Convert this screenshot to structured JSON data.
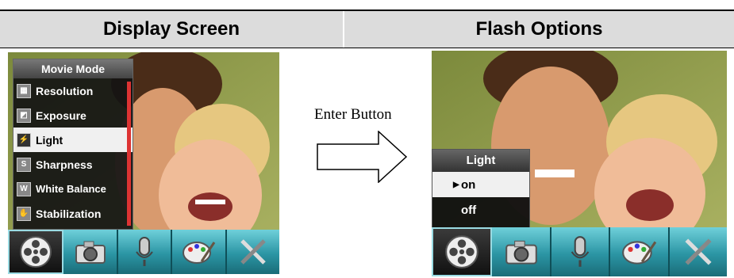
{
  "headers": {
    "left": "Display Screen",
    "right": "Flash Options"
  },
  "arrow_label": "Enter Button",
  "left_screen": {
    "menu": {
      "title": "Movie Mode",
      "items": [
        {
          "label": "Resolution",
          "icon": "resolution-icon",
          "selected": false
        },
        {
          "label": "Exposure",
          "icon": "exposure-icon",
          "selected": false
        },
        {
          "label": "Light",
          "icon": "light-icon",
          "selected": true
        },
        {
          "label": "Sharpness",
          "icon": "sharpness-icon",
          "selected": false
        },
        {
          "label": "White Balance",
          "icon": "white-balance-icon",
          "selected": false
        },
        {
          "label": "Stabilization",
          "icon": "stabilization-icon",
          "selected": false
        }
      ]
    }
  },
  "right_screen": {
    "popup": {
      "title": "Light",
      "options": [
        {
          "label": "on",
          "selected": true
        },
        {
          "label": "off",
          "selected": false
        }
      ]
    }
  },
  "toolbar_icons": [
    "movie-reel-icon",
    "camera-icon",
    "microphone-icon",
    "palette-icon",
    "tools-icon"
  ],
  "colors": {
    "toolbar": "#2b95a4",
    "scrollbar": "#dd3333",
    "header_bg": "#dcdcdc"
  }
}
